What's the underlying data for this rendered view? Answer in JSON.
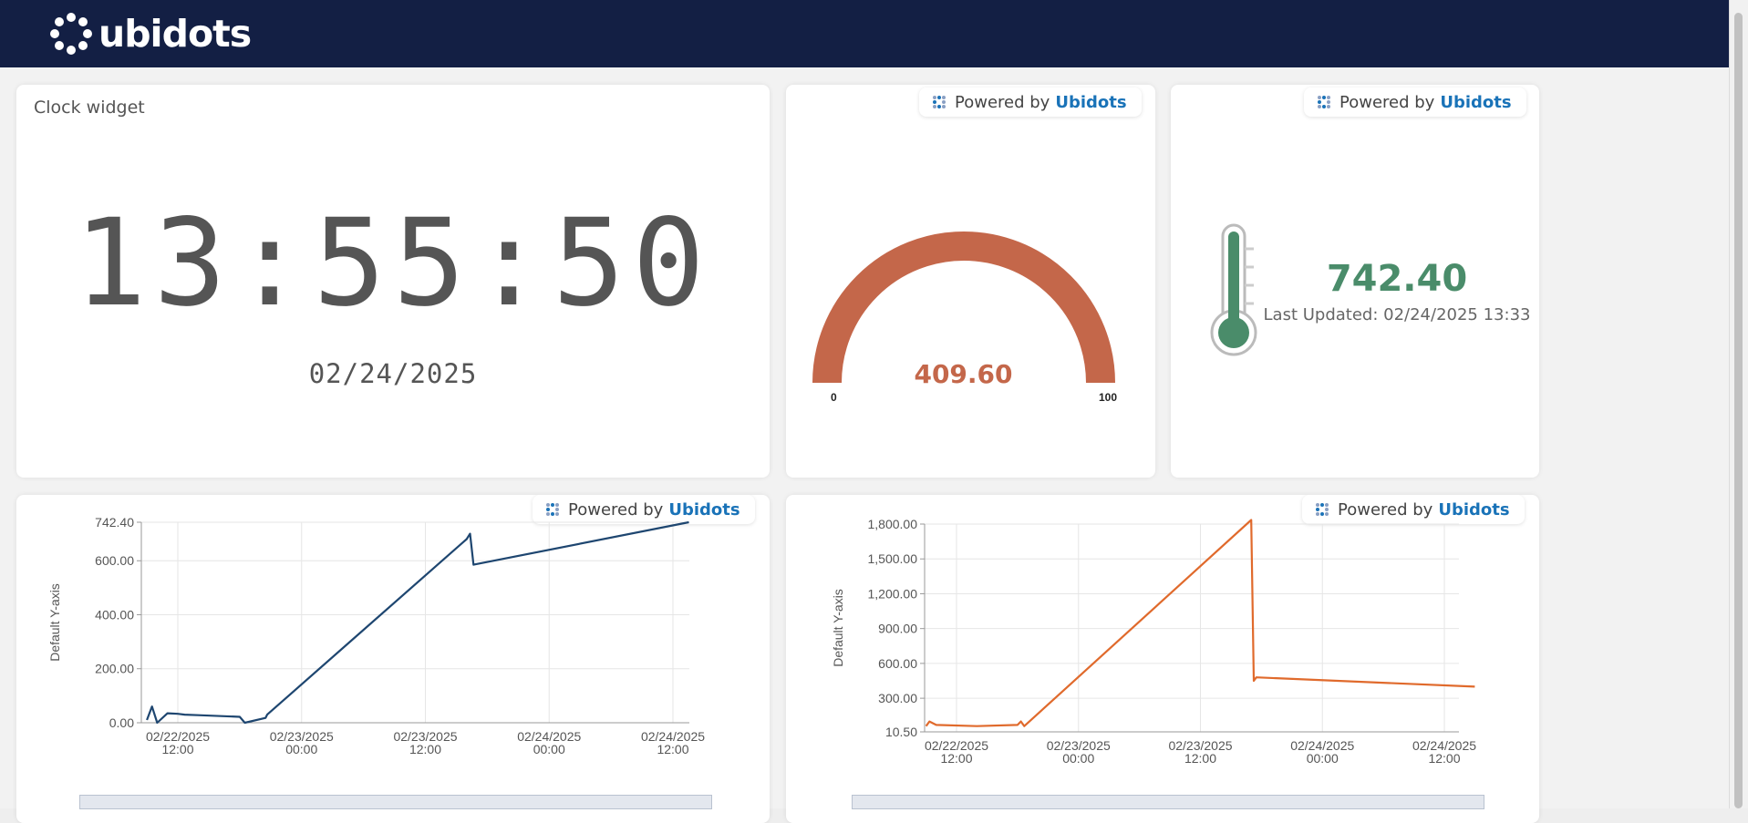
{
  "header": {
    "brand": "ubidots"
  },
  "badges": {
    "powered_by": "Powered by",
    "brand": "Ubidots"
  },
  "clock": {
    "title": "Clock widget",
    "time": "13:55:50",
    "date": "02/24/2025"
  },
  "gauge": {
    "value": "409.60",
    "min": "0",
    "max": "100",
    "fill_fraction": 1.0,
    "color": "#c4674a"
  },
  "thermometer": {
    "value": "742.40",
    "last_updated": "Last Updated: 02/24/2025 13:33",
    "color": "#4a8c6a"
  },
  "charts": [
    {
      "ylabel": "Default Y-axis",
      "color": "#1e4670",
      "y_ticks": [
        "742.40",
        "600.00",
        "400.00",
        "200.00",
        "0.00"
      ],
      "x_ticks": [
        [
          "02/22/2025",
          "12:00"
        ],
        [
          "02/23/2025",
          "00:00"
        ],
        [
          "02/23/2025",
          "12:00"
        ],
        [
          "02/24/2025",
          "00:00"
        ],
        [
          "02/24/2025",
          "12:00"
        ]
      ]
    },
    {
      "ylabel": "Default Y-axis",
      "color": "#e06a2c",
      "y_ticks": [
        "1,800.00",
        "1,500.00",
        "1,200.00",
        "900.00",
        "600.00",
        "300.00",
        "10.50"
      ],
      "x_ticks": [
        [
          "02/22/2025",
          "12:00"
        ],
        [
          "02/23/2025",
          "00:00"
        ],
        [
          "02/23/2025",
          "12:00"
        ],
        [
          "02/24/2025",
          "00:00"
        ],
        [
          "02/24/2025",
          "12:00"
        ]
      ]
    }
  ],
  "chart_data": [
    {
      "type": "line",
      "title": "",
      "xlabel": "",
      "ylabel": "Default Y-axis",
      "ylim": [
        0,
        742.4
      ],
      "x": [
        "2025-02-22 09:00",
        "2025-02-22 09:30",
        "2025-02-22 10:00",
        "2025-02-22 11:00",
        "2025-02-22 12:00",
        "2025-02-22 12:40",
        "2025-02-22 14:00",
        "2025-02-22 18:00",
        "2025-02-22 18:30",
        "2025-02-22 20:30",
        "2025-02-22 20:40",
        "2025-02-23 16:00",
        "2025-02-23 16:20",
        "2025-02-23 16:40",
        "2025-02-24 13:33"
      ],
      "series": [
        {
          "values": [
            10,
            60,
            0,
            35,
            33,
            30,
            28,
            22,
            0,
            18,
            30,
            680,
            700,
            585,
            742.4
          ]
        }
      ]
    },
    {
      "type": "line",
      "title": "",
      "xlabel": "",
      "ylabel": "Default Y-axis",
      "ylim": [
        10.5,
        1800
      ],
      "x": [
        "2025-02-22 09:00",
        "2025-02-22 09:20",
        "2025-02-22 10:00",
        "2025-02-22 14:00",
        "2025-02-22 18:00",
        "2025-02-22 18:20",
        "2025-02-22 18:40",
        "2025-02-23 17:00",
        "2025-02-23 17:15",
        "2025-02-23 17:30",
        "2025-02-24 15:00"
      ],
      "series": [
        {
          "values": [
            60,
            100,
            70,
            60,
            70,
            100,
            60,
            1835,
            450,
            480,
            400
          ]
        }
      ]
    }
  ]
}
